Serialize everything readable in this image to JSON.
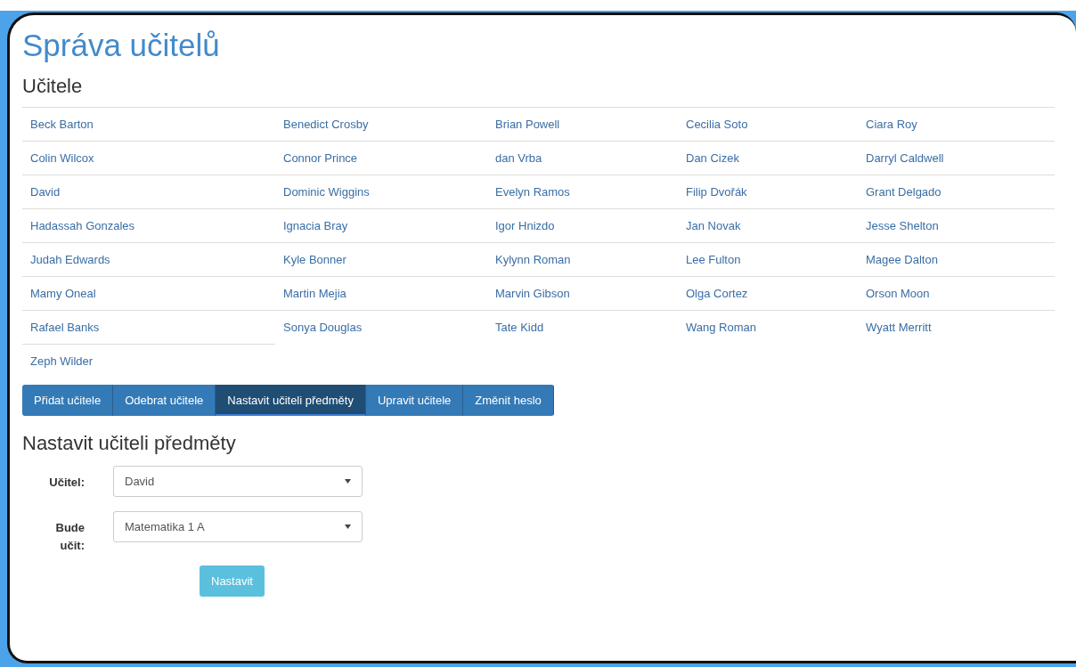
{
  "title": "Správa učitelů",
  "teachers_heading": "Učitele",
  "teachers": [
    "Beck Barton",
    "Benedict Crosby",
    "Brian Powell",
    "Cecilia Soto",
    "Ciara Roy",
    "Colin Wilcox",
    "Connor Prince",
    "dan Vrba",
    "Dan Cizek",
    "Darryl Caldwell",
    "David",
    "Dominic Wiggins",
    "Evelyn Ramos",
    "Filip Dvořák",
    "Grant Delgado",
    "Hadassah Gonzales",
    "Ignacia Bray",
    "Igor Hnizdo",
    "Jan Novak",
    "Jesse Shelton",
    "Judah Edwards",
    "Kyle Bonner",
    "Kylynn Roman",
    "Lee Fulton",
    "Magee Dalton",
    "Mamy Oneal",
    "Martin Mejia",
    "Marvin Gibson",
    "Olga Cortez",
    "Orson Moon",
    "Rafael Banks",
    "Sonya Douglas",
    "Tate Kidd",
    "Wang Roman",
    "Wyatt Merritt",
    "Zeph Wilder"
  ],
  "tabs": [
    {
      "label": "Přidat učitele",
      "selected": false
    },
    {
      "label": "Odebrat učitele",
      "selected": false
    },
    {
      "label": "Nastavit učiteli předměty",
      "selected": true
    },
    {
      "label": "Upravit učitele",
      "selected": false
    },
    {
      "label": "Změnit heslo",
      "selected": false
    }
  ],
  "form": {
    "heading": "Nastavit učiteli předměty",
    "fields": [
      {
        "label": "Učitel:",
        "value": "David"
      },
      {
        "label": "Bude učit:",
        "value": "Matematika 1 A"
      }
    ],
    "submit": "Nastavit"
  }
}
